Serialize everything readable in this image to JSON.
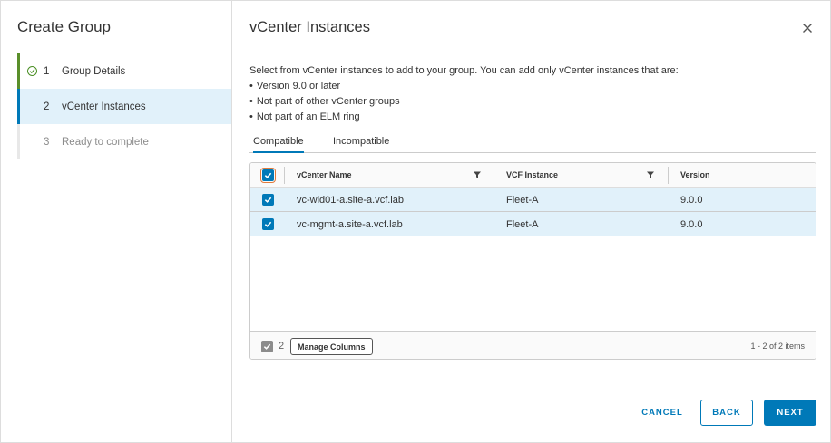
{
  "sidebar": {
    "title": "Create Group",
    "steps": [
      {
        "number": "1",
        "label": "Group Details",
        "state": "done"
      },
      {
        "number": "2",
        "label": "vCenter Instances",
        "state": "active"
      },
      {
        "number": "3",
        "label": "Ready to complete",
        "state": "pending"
      }
    ]
  },
  "main": {
    "title": "vCenter Instances",
    "description": "Select from vCenter instances to add to your group. You can add only vCenter instances that are:",
    "bullets": [
      "Version 9.0 or later",
      "Not part of other vCenter groups",
      "Not part of an ELM ring"
    ],
    "tabs": [
      {
        "label": "Compatible",
        "active": true
      },
      {
        "label": "Incompatible",
        "active": false
      }
    ],
    "grid": {
      "columns": [
        "vCenter Name",
        "VCF Instance",
        "Version"
      ],
      "rows": [
        {
          "name": "vc-wld01-a.site-a.vcf.lab",
          "instance": "Fleet-A",
          "version": "9.0.0",
          "selected": true
        },
        {
          "name": "vc-mgmt-a.site-a.vcf.lab",
          "instance": "Fleet-A",
          "version": "9.0.0",
          "selected": true
        }
      ],
      "footer": {
        "selected_count": "2",
        "manage_columns": "Manage Columns",
        "pagination": "1 - 2 of 2 items"
      }
    }
  },
  "buttons": {
    "cancel": "CANCEL",
    "back": "BACK",
    "next": "NEXT"
  },
  "colors": {
    "accent": "#0079b8",
    "selected_row": "#e1f1fa",
    "done_step": "#5a8f2a"
  },
  "icons": [
    "check-circle-icon",
    "close-icon",
    "filter-icon",
    "checkbox-checked-icon"
  ]
}
